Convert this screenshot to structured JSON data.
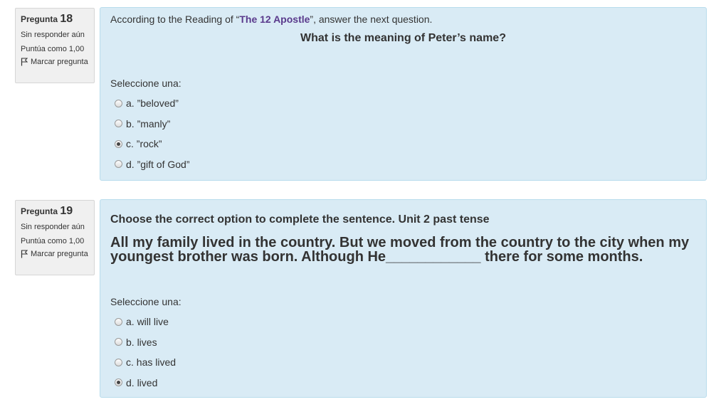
{
  "questions": [
    {
      "info": {
        "prefix": "Pregunta",
        "number": "18",
        "state": "Sin responder aún",
        "grade": "Puntúa como 1,00",
        "flag_label": "Marcar pregunta"
      },
      "intro_before": "According to the Reading of “",
      "intro_ref": "The 12 Apostle",
      "intro_after": "”, answer the next question.",
      "question": "What is the meaning of Peter’s name?",
      "prompt": "Seleccione una:",
      "options": [
        {
          "label": "a. ”beloved”",
          "checked": false
        },
        {
          "label": "b. ”manly”",
          "checked": false
        },
        {
          "label": "c. ”rock”",
          "checked": true
        },
        {
          "label": "d. ”gift of God”",
          "checked": false
        }
      ]
    },
    {
      "info": {
        "prefix": "Pregunta",
        "number": "19",
        "state": "Sin responder aún",
        "grade": "Puntúa como 1,00",
        "flag_label": "Marcar pregunta"
      },
      "heading": "Choose the correct option to complete the sentence.  Unit 2 past tense",
      "body": "All my family lived in the country. But we moved from the country to the city when my youngest brother was born. Although He____________ there for some months.",
      "prompt": "Seleccione una:",
      "options": [
        {
          "label": "a. will live",
          "checked": false
        },
        {
          "label": "b. lives",
          "checked": false
        },
        {
          "label": "c. has lived",
          "checked": false
        },
        {
          "label": "d. lived",
          "checked": true
        }
      ]
    }
  ],
  "icons": {
    "flag": "flag-icon",
    "radio": "radio-button"
  }
}
